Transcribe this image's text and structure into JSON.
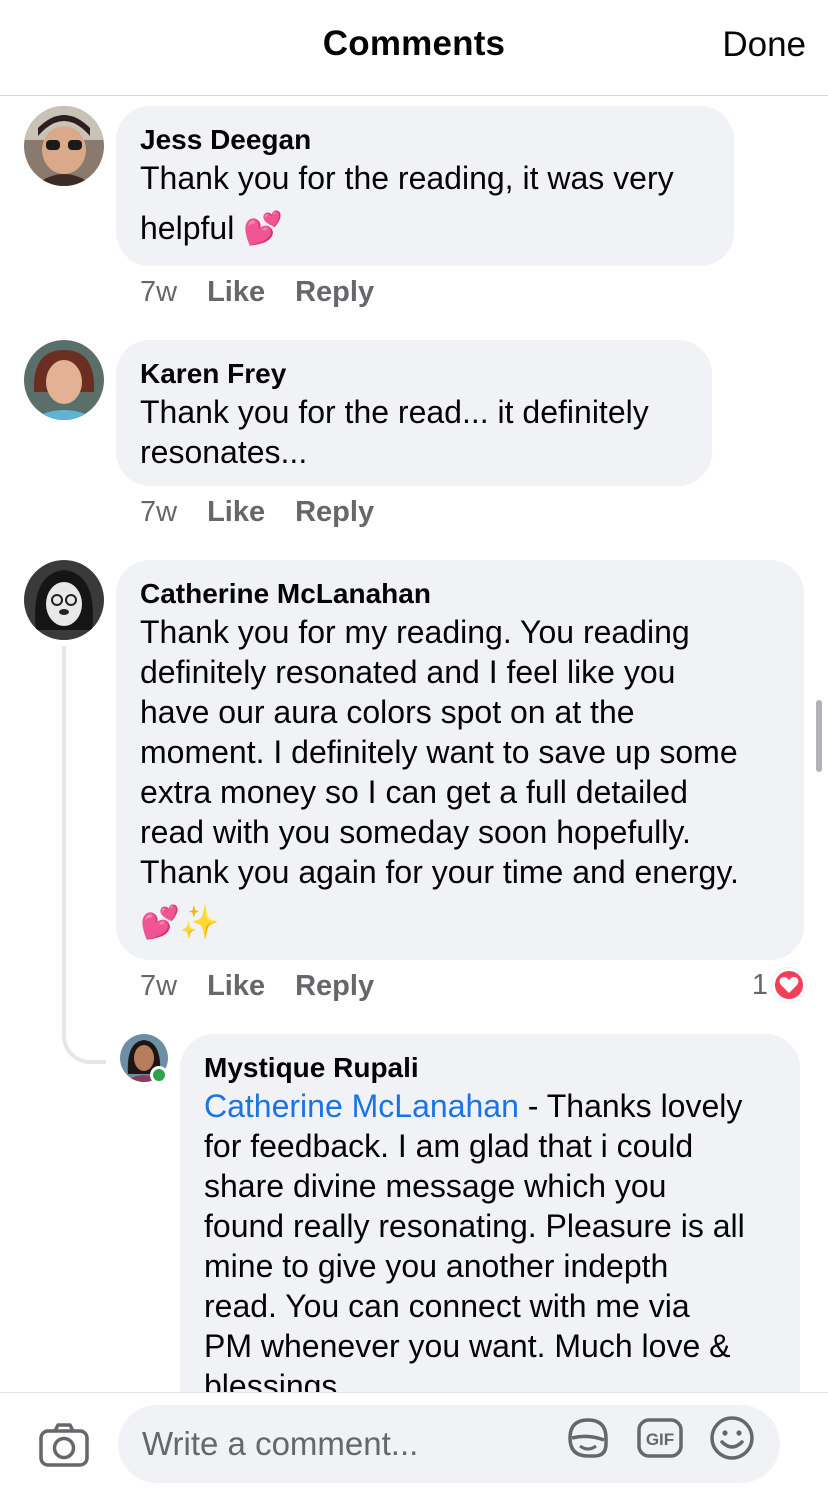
{
  "header": {
    "title": "Comments",
    "done_label": "Done"
  },
  "comments": [
    {
      "author": "Jess Deegan",
      "lines": [
        "Thank you for the reading, it was very",
        "helpful 💕"
      ],
      "time": "7w",
      "like_label": "Like",
      "reply_label": "Reply"
    },
    {
      "author": "Karen Frey",
      "lines": [
        "Thank you for the read... it definitely",
        "resonates..."
      ],
      "time": "7w",
      "like_label": "Like",
      "reply_label": "Reply"
    },
    {
      "author": "Catherine McLanahan",
      "lines": [
        "Thank you for my reading. You reading",
        "definitely resonated and I feel like you",
        "have our aura colors spot on at the",
        "moment. I definitely want to save up some",
        "extra money so I can get a full detailed",
        "read with you someday soon hopefully.",
        "Thank you again for your time and energy.",
        "💕✨"
      ],
      "time": "7w",
      "like_label": "Like",
      "reply_label": "Reply",
      "reaction_count": "1"
    }
  ],
  "reply": {
    "author": "Mystique Rupali",
    "mention": "Catherine McLanahan",
    "first_line_rest": " - Thanks lovely",
    "lines": [
      "for feedback. I am glad that i could",
      "share divine message which you",
      "found really resonating. Pleasure is all",
      "mine to give you another indepth",
      "read. You can connect with me via",
      "PM whenever you want. Much love &",
      "blessings"
    ]
  },
  "composer": {
    "placeholder": "Write a comment..."
  },
  "colors": {
    "bubble": "#f0f2f5",
    "mention": "#1b74e4",
    "meta": "#65676b",
    "heart": "#f33e58",
    "online": "#31a24c"
  },
  "icons": [
    "camera-icon",
    "sticker-icon",
    "gif-icon",
    "emoji-icon",
    "heart-icon"
  ]
}
